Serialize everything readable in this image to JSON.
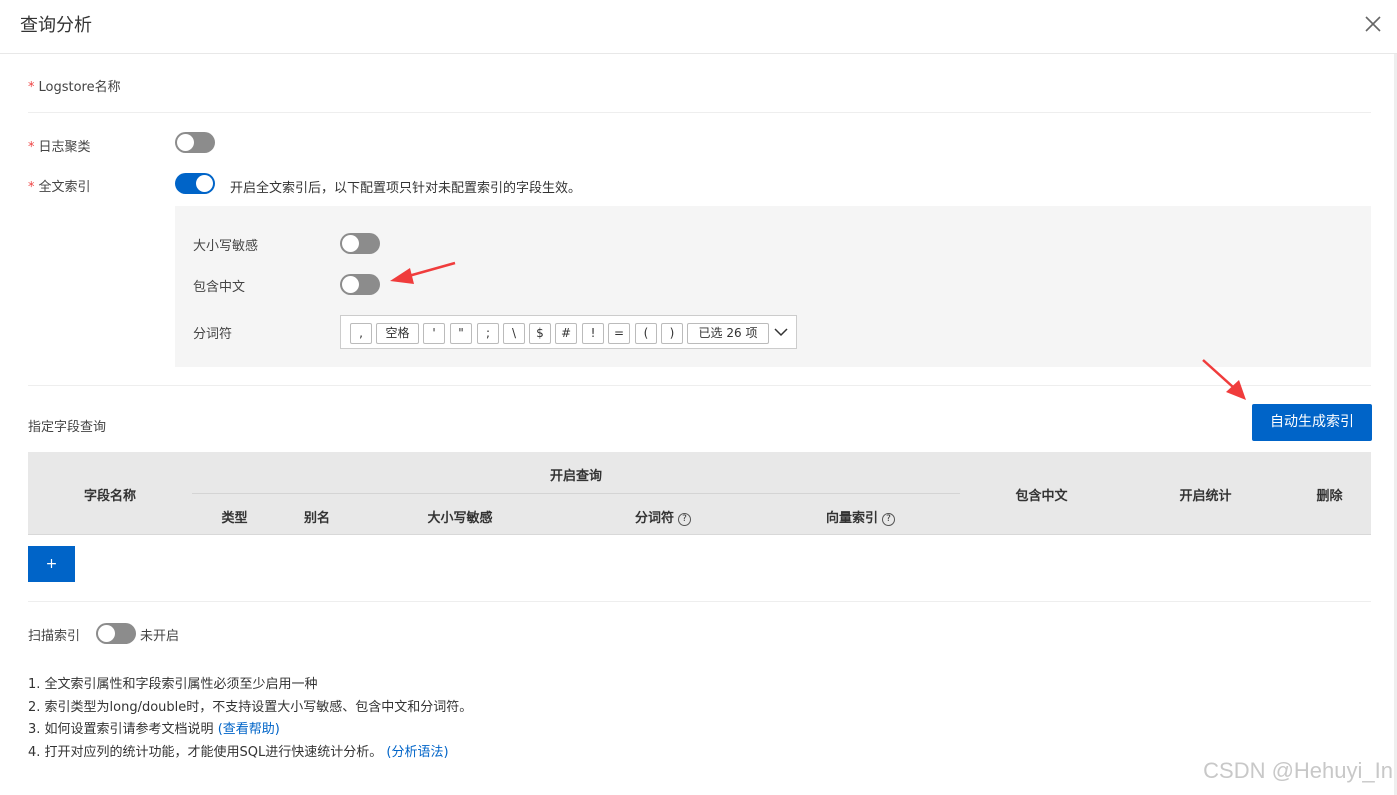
{
  "dialog": {
    "title": "查询分析"
  },
  "form": {
    "logstore_label": "Logstore名称",
    "log_cluster_label": "日志聚类",
    "full_text_label": "全文索引",
    "full_text_desc": "开启全文索引后，以下配置项只针对未配置索引的字段生效。",
    "case_sensitive_label": "大小写敏感",
    "include_chinese_label": "包含中文",
    "delimiter_label": "分词符",
    "delimiters": [
      ",",
      "空格",
      "'",
      "\"",
      ";",
      "\\",
      "$",
      "#",
      "!",
      "=",
      "(",
      ")"
    ],
    "selected_count": "已选 26 项"
  },
  "field_query": {
    "title": "指定字段查询",
    "auto_button": "自动生成索引",
    "add_button": "+",
    "columns": {
      "field_name": "字段名称",
      "enable_query": "开启查询",
      "type": "类型",
      "alias": "别名",
      "case_sensitive": "大小写敏感",
      "delimiter": "分词符",
      "vector_index": "向量索引",
      "include_chinese": "包含中文",
      "enable_stats": "开启统计",
      "delete": "删除"
    }
  },
  "scan_index": {
    "label": "扫描索引",
    "status": "未开启"
  },
  "notes": [
    "1. 全文索引属性和字段索引属性必须至少启用一种",
    "2. 索引类型为long/double时，不支持设置大小写敏感、包含中文和分词符。",
    "3. 如何设置索引请参考文档说明",
    "4. 打开对应列的统计功能，才能使用SQL进行快速统计分析。"
  ],
  "links": {
    "help": "(查看帮助)",
    "syntax": "(分析语法)"
  },
  "watermark": "CSDN @Hehuyi_In",
  "switches": {
    "log_cluster": false,
    "full_text": true,
    "case_sensitive": false,
    "include_chinese": false,
    "scan_index": false
  },
  "colors": {
    "primary": "#0064c8",
    "required": "#ee4444",
    "arrow": "#f03c3c"
  }
}
